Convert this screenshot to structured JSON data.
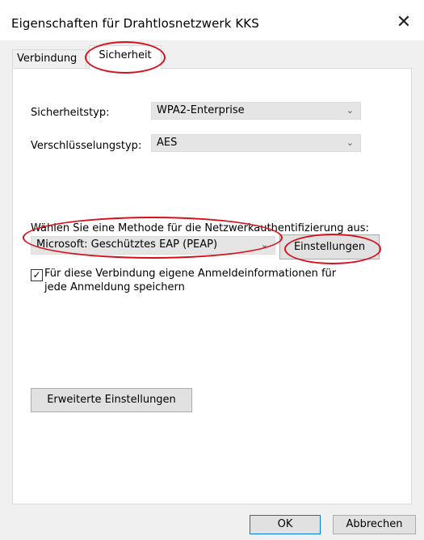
{
  "window": {
    "title": "Eigenschaften für Drahtlosnetzwerk KKS",
    "close_glyph": "✕"
  },
  "tabs": [
    {
      "label": "Verbindung",
      "active": false
    },
    {
      "label": "Sicherheit",
      "active": true
    }
  ],
  "security": {
    "type_label": "Sicherheitstyp:",
    "type_value": "WPA2-Enterprise",
    "encryption_label": "Verschlüsselungstyp:",
    "encryption_value": "AES",
    "method_label": "Wählen Sie eine Methode für die Netzwerkauthentifizierung aus:",
    "method_value": "Microsoft: Geschütztes EAP (PEAP)",
    "settings_button": "Einstellungen",
    "remember_checkbox": {
      "checked": true,
      "label_line1": "Für diese Verbindung eigene Anmeldeinformationen für",
      "label_line2": "jede Anmeldung speichern"
    },
    "advanced_button": "Erweiterte Einstellungen"
  },
  "footer": {
    "ok_button": "OK",
    "cancel_button": "Abbrechen"
  },
  "colors": {
    "annotation_red": "#d6111c",
    "combo_bg": "#e5e5e5",
    "button_bg": "#e1e1e1"
  },
  "icons": {
    "close": "close-icon",
    "dropdown": "chevron-down-icon",
    "check": "checkmark-icon"
  }
}
